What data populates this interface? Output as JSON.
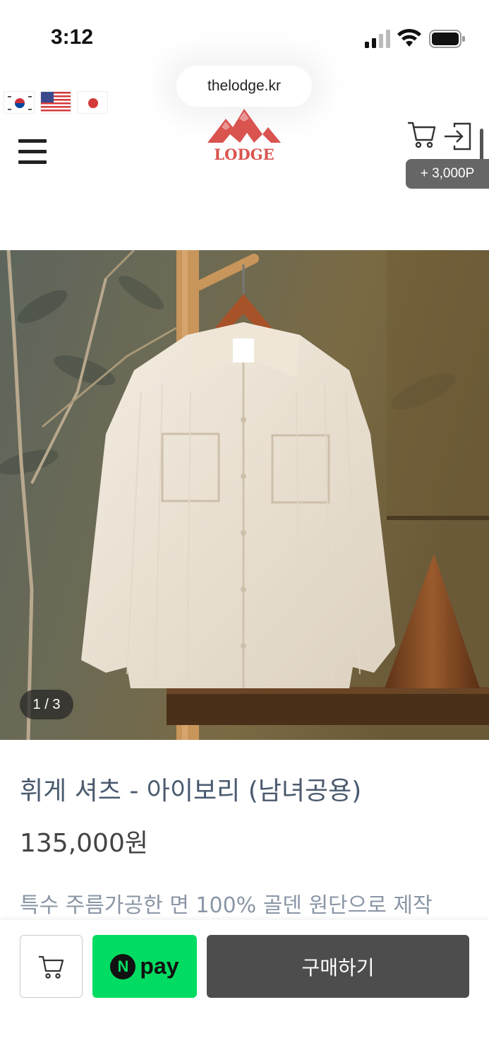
{
  "status_bar": {
    "time": "3:12",
    "icons": [
      "signal-icon",
      "wifi-icon",
      "battery-icon"
    ]
  },
  "browser": {
    "url": "thelodge.kr"
  },
  "languages": [
    {
      "name": "korean-flag-icon"
    },
    {
      "name": "us-flag-icon"
    },
    {
      "name": "japan-flag-icon"
    }
  ],
  "header": {
    "logo_text": "LODGE",
    "points_badge": "+ 3,000P",
    "icons": [
      "menu-icon",
      "cart-icon",
      "login-icon"
    ]
  },
  "gallery": {
    "counter": "1 / 3"
  },
  "product": {
    "title": "휘게 셔츠 - 아이보리 (남녀공용)",
    "price": "135,000원",
    "description": "특수 주름가공한 면 100% 골덴 원단으로 제작"
  },
  "actions": {
    "npay_n": "N",
    "npay_label": "pay",
    "buy_label": "구매하기"
  },
  "colors": {
    "logo_red": "#d9534f",
    "npay_green": "#03dc63",
    "buy_button": "#4d4d4d",
    "title_text": "#4a5a6e"
  }
}
